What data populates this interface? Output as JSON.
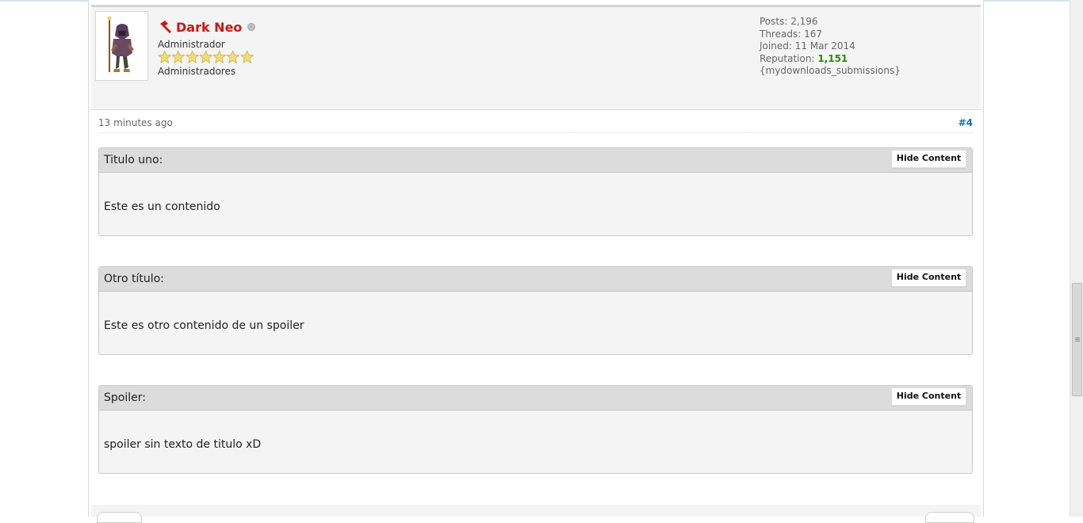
{
  "post": {
    "author": {
      "name": "Dark Neo",
      "title": "Administrador",
      "group": "Administradores",
      "stars": 7,
      "online_status": "offline"
    },
    "stats": {
      "posts": "Posts: 2,196",
      "threads": "Threads: 167",
      "joined": "Joined: 11 Mar 2014",
      "reputation_label": "Reputation:",
      "reputation_value": "1,151",
      "reputation_extra": "{mydownloads_submissions}"
    },
    "time": "13 minutes ago",
    "number": "#4",
    "spoilers": [
      {
        "title": "Titulo uno:",
        "button": "Hide Content",
        "content": "Este es un contenido"
      },
      {
        "title": "Otro título:",
        "button": "Hide Content",
        "content": "Este es otro contenido de un spoiler"
      },
      {
        "title": "Spoiler:",
        "button": "Hide Content",
        "content": "spoiler sin texto de titulo xD"
      }
    ]
  },
  "colors": {
    "username": "#cc1515",
    "reputation": "#2a8a0e",
    "post_number": "#1a6fb0",
    "header_bg": "#f4f4f4",
    "spoiler_head": "#dcdcdc"
  }
}
